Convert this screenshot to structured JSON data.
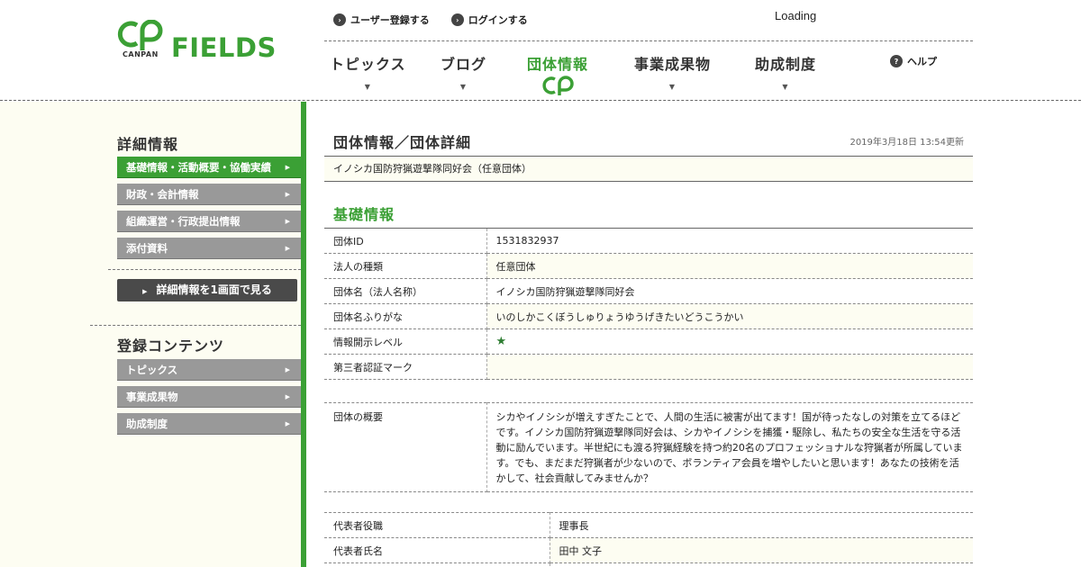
{
  "header": {
    "logo": {
      "canpan": "CANPAN",
      "fields": "FIELDS"
    },
    "top_links": [
      {
        "label": "ユーザー登録する",
        "icon": "arrow-circle-icon"
      },
      {
        "label": "ログインする",
        "icon": "arrow-circle-icon"
      }
    ],
    "loading": "Loading",
    "nav": [
      {
        "label": "トピックス"
      },
      {
        "label": "ブログ"
      },
      {
        "label": "団体情報",
        "active": true
      },
      {
        "label": "事業成果物"
      },
      {
        "label": "助成制度"
      }
    ],
    "help": "ヘルプ",
    "accent_color": "#3ba035"
  },
  "sidebar": {
    "detail_title": "詳細情報",
    "detail_items": [
      {
        "label": "基礎情報・活動概要・協働実績",
        "active": true
      },
      {
        "label": "財政・会計情報"
      },
      {
        "label": "組織運営・行政提出情報"
      },
      {
        "label": "添付資料"
      }
    ],
    "one_page_button": "詳細情報を1画面で見る",
    "content_title": "登録コンテンツ",
    "content_items": [
      {
        "label": "トピックス"
      },
      {
        "label": "事業成果物"
      },
      {
        "label": "助成制度"
      }
    ]
  },
  "main": {
    "page_title": "団体情報／団体詳細",
    "updated": "2019年3月18日 13:54更新",
    "org_name_bar": "イノシカ国防狩猟遊撃隊同好会（任意団体）",
    "section_title": "基礎情報",
    "basic_rows": [
      {
        "label": "団体ID",
        "value": "1531832937"
      },
      {
        "label": "法人の種類",
        "value": "任意団体"
      },
      {
        "label": "団体名（法人名称）",
        "value": "イノシカ国防狩猟遊撃隊同好会"
      },
      {
        "label": "団体名ふりがな",
        "value": "いのしかこくぼうしゅりょうゆうげきたいどうこうかい"
      },
      {
        "label": "情報開示レベル",
        "value": "★",
        "icon": "star-icon"
      },
      {
        "label": "第三者認証マーク",
        "value": ""
      }
    ],
    "overview": {
      "label": "団体の概要",
      "value": "シカやイノシシが増えすぎたことで、人間の生活に被害が出てます！国が待ったなしの対策を立てるほどです。イノシカ国防狩猟遊撃隊同好会は、シカやイノシシを捕獲・駆除し、私たちの安全な生活を守る活動に励んでいます。半世紀にも渡る狩猟経験を持つ約20名のプロフェッショナルな狩猟者が所属しています。でも、まだまだ狩猟者が少ないので、ボランティア会員を増やしたいと思います！あなたの技術を活かして、社会貢献してみませんか？"
    },
    "rep_rows": [
      {
        "label": "代表者役職",
        "value": "理事長"
      },
      {
        "label": "代表者氏名",
        "value": "田中 文子"
      }
    ]
  }
}
